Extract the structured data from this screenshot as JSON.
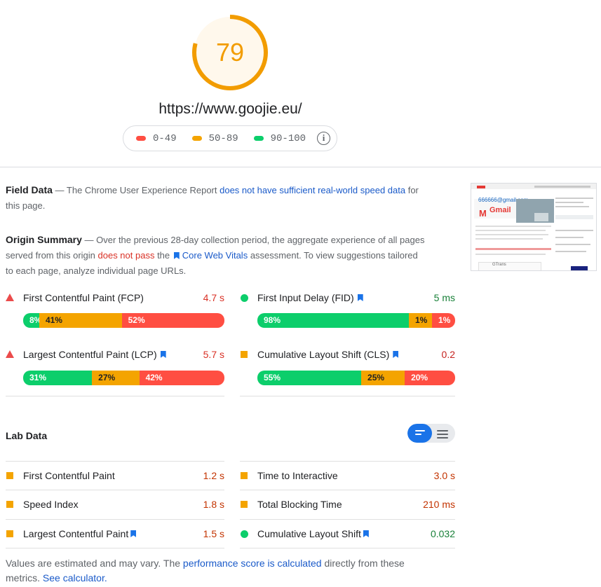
{
  "score": {
    "value": "79",
    "percent": 79,
    "color": "#f29c00"
  },
  "url": "https://www.goojie.eu/",
  "legend": [
    {
      "label": "0-49",
      "color": "#ff4e42"
    },
    {
      "label": "50-89",
      "color": "#f4a400"
    },
    {
      "label": "90-100",
      "color": "#0cce6b"
    }
  ],
  "info_icon": "i",
  "field_data": {
    "title": "Field Data",
    "sep": " — ",
    "text1": "The Chrome User Experience Report ",
    "link": "does not have sufficient real-world speed data",
    "text2": " for this page."
  },
  "origin_summary": {
    "title": "Origin Summary",
    "sep": " — ",
    "text1": "Over the previous 28-day collection period, the aggregate experience of all pages served from this origin ",
    "fail": "does not pass",
    "text2": " the ",
    "link": "Core Web Vitals",
    "text3": " assessment. To view suggestions tailored to each page, analyze individual page URLs."
  },
  "field_metrics": [
    {
      "name": "First Contentful Paint (FCP)",
      "value": "4.7 s",
      "value_color": "#d93025",
      "indicator": "triangle",
      "bookmark": false,
      "dist": [
        {
          "label": "8%",
          "pct": 8
        },
        {
          "label": "41%",
          "pct": 41
        },
        {
          "label": "52%",
          "pct": 52
        }
      ]
    },
    {
      "name": "First Input Delay (FID)",
      "value": "5 ms",
      "value_color": "#188038",
      "indicator": "circle",
      "bookmark": true,
      "dist": [
        {
          "label": "98%",
          "pct": 98
        },
        {
          "label": "1%",
          "pct": 1
        },
        {
          "label": "1%",
          "pct": 1
        }
      ]
    },
    {
      "name": "Largest Contentful Paint (LCP)",
      "value": "5.7 s",
      "value_color": "#d93025",
      "indicator": "triangle",
      "bookmark": true,
      "dist": [
        {
          "label": "31%",
          "pct": 31
        },
        {
          "label": "27%",
          "pct": 27
        },
        {
          "label": "42%",
          "pct": 42
        }
      ]
    },
    {
      "name": "Cumulative Layout Shift (CLS)",
      "value": "0.2",
      "value_color": "#c5221f",
      "indicator": "square",
      "bookmark": true,
      "dist": [
        {
          "label": "55%",
          "pct": 55
        },
        {
          "label": "25%",
          "pct": 25
        },
        {
          "label": "20%",
          "pct": 20
        }
      ]
    }
  ],
  "lab": {
    "title": "Lab Data",
    "metrics": [
      {
        "name": "First Contentful Paint",
        "value": "1.2 s",
        "value_color": "#c33300",
        "indicator": "square",
        "bookmark": false
      },
      {
        "name": "Time to Interactive",
        "value": "3.0 s",
        "value_color": "#c33300",
        "indicator": "square",
        "bookmark": false
      },
      {
        "name": "Speed Index",
        "value": "1.8 s",
        "value_color": "#c33300",
        "indicator": "square",
        "bookmark": false
      },
      {
        "name": "Total Blocking Time",
        "value": "210 ms",
        "value_color": "#c33300",
        "indicator": "square",
        "bookmark": false
      },
      {
        "name": "Largest Contentful Paint",
        "value": "1.5 s",
        "value_color": "#c33300",
        "indicator": "square",
        "bookmark": true
      },
      {
        "name": "Cumulative Layout Shift",
        "value": "0.032",
        "value_color": "#188038",
        "indicator": "circle",
        "bookmark": true
      }
    ]
  },
  "footer": {
    "text1": "Values are estimated and may vary. The ",
    "link1": "performance score is calculated",
    "text2": " directly from these metrics. ",
    "link2": "See calculator."
  },
  "thumbnail": {
    "gmail_text": "Gmail",
    "email_text": "666666@gmail.com",
    "caption": "GTrans"
  }
}
